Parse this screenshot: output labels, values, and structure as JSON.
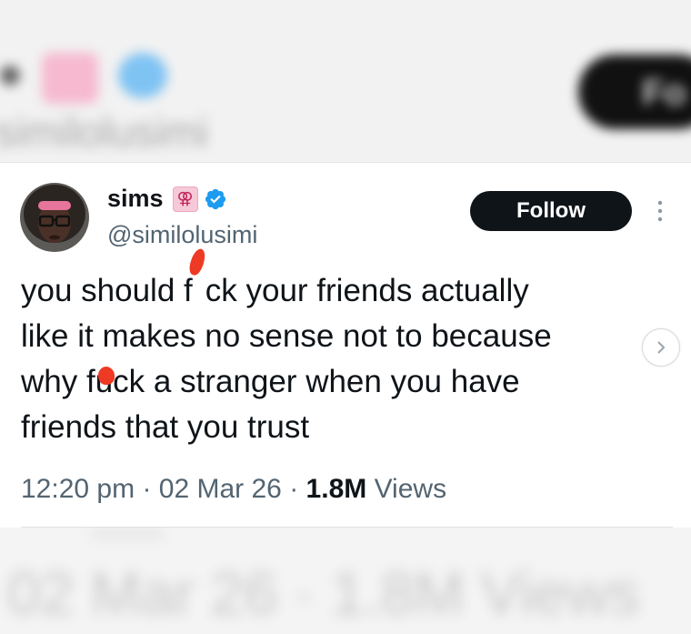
{
  "background": {
    "top_handle": "similolusimi",
    "top_button": "Fo",
    "bottom_meta": "02 Mar 26 · 1.8M Views"
  },
  "tweet": {
    "display_name": "sims",
    "name_emoji": "⚢",
    "verified_icon": "verified-badge-icon",
    "handle": "@similolusimi",
    "follow_label": "Follow",
    "text_lines": [
      [
        "you should f",
        "",
        "ck your friends actually"
      ],
      [
        "like it makes no sense not to because"
      ],
      [
        "why fu",
        "",
        "ck a stranger when you have"
      ],
      [
        "friends that you trust"
      ]
    ],
    "time": "12:20 pm",
    "sep": "·",
    "date": "02 Mar 26",
    "views_count": "1.8M",
    "views_label": "Views"
  },
  "colors": {
    "accent_verified": "#1d9bf0",
    "follow_bg": "#0f1419",
    "redaction_mark": "#ee3a24",
    "meta_gray": "#536471"
  },
  "icons": [
    "more-options-icon",
    "chevron-right-icon",
    "verified-badge-icon"
  ]
}
